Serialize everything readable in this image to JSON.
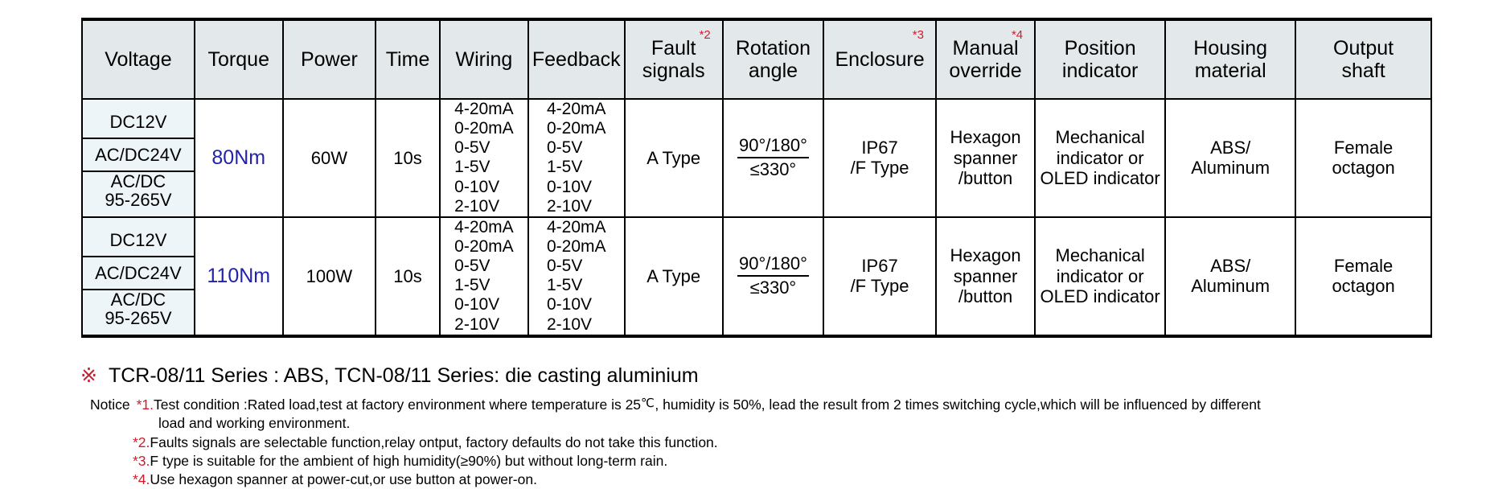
{
  "table": {
    "columns": [
      {
        "label": "Voltage",
        "note": null
      },
      {
        "label": "Torque",
        "note": null
      },
      {
        "label": "Power",
        "note": null
      },
      {
        "label": "Time",
        "note": null
      },
      {
        "label": "Wiring",
        "note": null
      },
      {
        "label": "Feedback",
        "note": null
      },
      {
        "label": "Fault\nsignals",
        "line1": "Fault",
        "line2": "signals",
        "note": "*2"
      },
      {
        "label": "Rotation\nangle",
        "line1": "Rotation",
        "line2": "angle",
        "note": null
      },
      {
        "label": "Enclosure",
        "note": "*3"
      },
      {
        "label": "Manual\noverride",
        "line1": "Manual",
        "line2": "override",
        "note": "*4"
      },
      {
        "label": "Position\nindicator",
        "line1": "Position",
        "line2": "indicator",
        "note": null
      },
      {
        "label": "Housing\nmaterial",
        "line1": "Housing",
        "line2": "material",
        "note": null
      },
      {
        "label": "Output\nshaft",
        "line1": "Output",
        "line2": "shaft",
        "note": null
      }
    ],
    "rows": [
      {
        "voltage": [
          "DC12V",
          "AC/DC24V",
          "AC/DC 95-265V"
        ],
        "voltage_split": [
          [
            "DC12V"
          ],
          [
            "AC/DC24V"
          ],
          [
            "AC/DC",
            "95-265V"
          ]
        ],
        "torque": "80Nm",
        "power": "60W",
        "time": "10s",
        "wiring": [
          "4-20mA",
          "0-20mA",
          "0-5V",
          "1-5V",
          "0-10V",
          "2-10V"
        ],
        "feedback": [
          "4-20mA",
          "0-20mA",
          "0-5V",
          "1-5V",
          "0-10V",
          "2-10V"
        ],
        "fault_signals": "A Type",
        "rotation_angle_num": "90°/180°",
        "rotation_angle_den": "≤330°",
        "enclosure": [
          "IP67",
          "/F Type"
        ],
        "manual_override": [
          "Hexagon",
          "spanner",
          "/button"
        ],
        "position_indicator": [
          "Mechanical",
          "indicator or",
          "OLED indicator"
        ],
        "housing_material": [
          "ABS/",
          "Aluminum"
        ],
        "output_shaft": [
          "Female",
          "octagon"
        ]
      },
      {
        "voltage": [
          "DC12V",
          "AC/DC24V",
          "AC/DC 95-265V"
        ],
        "voltage_split": [
          [
            "DC12V"
          ],
          [
            "AC/DC24V"
          ],
          [
            "AC/DC",
            "95-265V"
          ]
        ],
        "torque": "110Nm",
        "power": "100W",
        "time": "10s",
        "wiring": [
          "4-20mA",
          "0-20mA",
          "0-5V",
          "1-5V",
          "0-10V",
          "2-10V"
        ],
        "feedback": [
          "4-20mA",
          "0-20mA",
          "0-5V",
          "1-5V",
          "0-10V",
          "2-10V"
        ],
        "fault_signals": "A Type",
        "rotation_angle_num": "90°/180°",
        "rotation_angle_den": "≤330°",
        "enclosure": [
          "IP67",
          "/F Type"
        ],
        "manual_override": [
          "Hexagon",
          "spanner",
          "/button"
        ],
        "position_indicator": [
          "Mechanical",
          "indicator or",
          "OLED indicator"
        ],
        "housing_material": [
          "ABS/",
          "Aluminum"
        ],
        "output_shaft": [
          "Female",
          "octagon"
        ]
      }
    ]
  },
  "series_note": {
    "mark": "※",
    "text": "TCR-08/11 Series : ABS, TCN-08/11 Series: die casting aluminium"
  },
  "footnotes": {
    "notice_label": "Notice",
    "items": [
      {
        "num": "*1.",
        "text_part1": "Test condition :Rated load,test at factory environment where temperature is 25",
        "degree": "℃",
        "text_part2": ", humidity is 50%, lead the result from 2 times switching cycle,which will be influenced by different",
        "continuation": "load and working environment."
      },
      {
        "num": "*2.",
        "text": "Faults signals are selectable function,relay ontput, factory defaults do not take this function."
      },
      {
        "num": "*3.",
        "text": "F type is suitable for the ambient of high humidity(≥90%) but without long-term rain."
      },
      {
        "num": "*4.",
        "text": "Use hexagon spanner at power-cut,or use button at power-on."
      }
    ]
  },
  "colors": {
    "header_bg": "#e3e9ea",
    "voltage_bg": "#eef5f8",
    "accent_red": "#d21b2c",
    "torque_blue": "#2222aa",
    "border": "#000000"
  }
}
